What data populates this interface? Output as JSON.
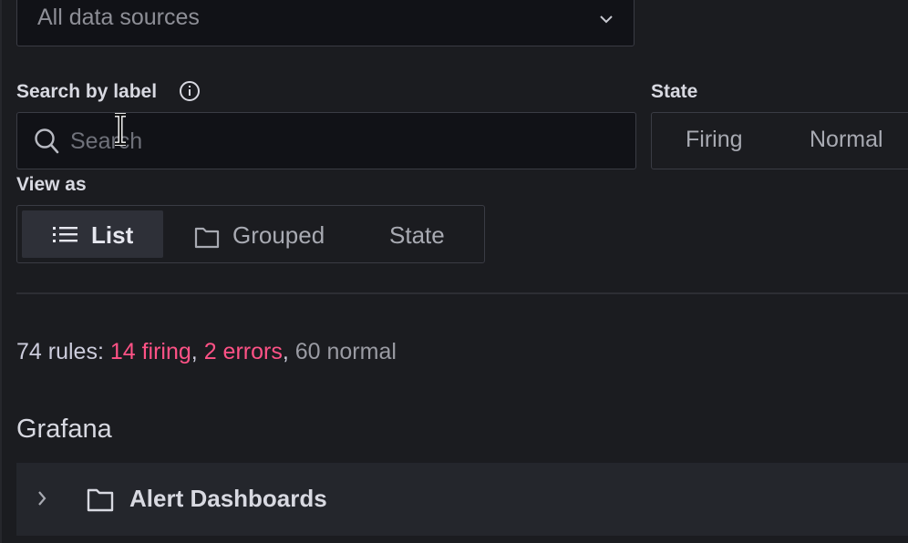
{
  "datasource": {
    "value": "All data sources"
  },
  "search": {
    "label": "Search by label",
    "placeholder": "Search"
  },
  "state": {
    "label": "State",
    "options": [
      "Firing",
      "Normal"
    ]
  },
  "view": {
    "label": "View as",
    "options": [
      "List",
      "Grouped",
      "State"
    ],
    "selected": "List"
  },
  "summary": {
    "prefix": "74 rules: ",
    "firing": "14 firing",
    "sep1": ", ",
    "errors": "2 errors",
    "sep2": ", ",
    "normal": "60 normal"
  },
  "section": {
    "title": "Grafana"
  },
  "folders": [
    {
      "name": "Alert Dashboards"
    }
  ],
  "colors": {
    "background": "#1b1c20",
    "accent_pink": "#ff5286",
    "panel": "#24262c"
  },
  "icons": [
    "chevron-down-icon",
    "info-icon",
    "search-icon",
    "text-cursor-icon",
    "list-icon",
    "folder-icon",
    "chevron-right-icon"
  ]
}
